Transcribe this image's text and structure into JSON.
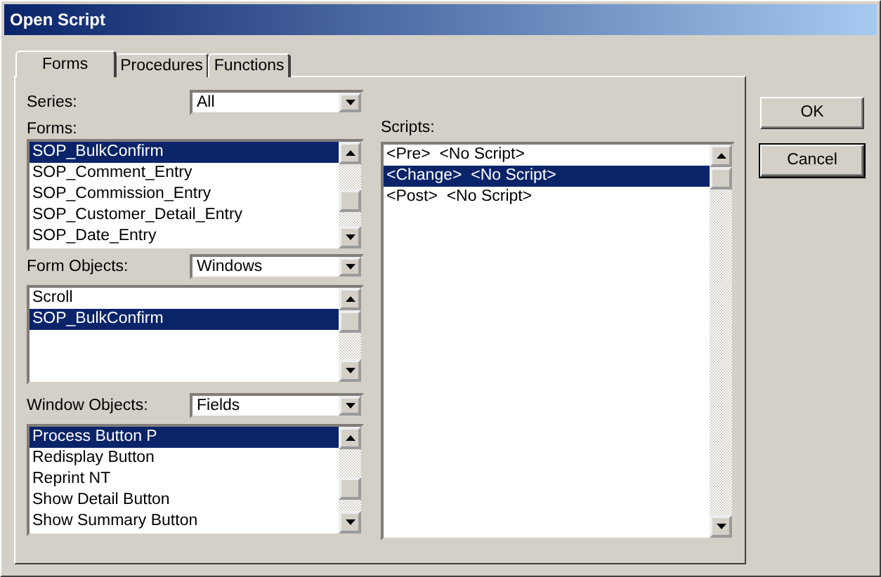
{
  "window": {
    "title": "Open Script"
  },
  "tabs": [
    {
      "label": "Forms",
      "selected": true
    },
    {
      "label": "Procedures",
      "selected": false
    },
    {
      "label": "Functions",
      "selected": false
    }
  ],
  "series": {
    "label": "Series:",
    "value": "All"
  },
  "forms": {
    "label": "Forms:",
    "items": [
      {
        "text": "SOP_BulkConfirm",
        "selected": true
      },
      {
        "text": "SOP_Comment_Entry",
        "selected": false
      },
      {
        "text": "SOP_Commission_Entry",
        "selected": false
      },
      {
        "text": "SOP_Customer_Detail_Entry",
        "selected": false
      },
      {
        "text": "SOP_Date_Entry",
        "selected": false
      }
    ]
  },
  "form_objects": {
    "label": "Form Objects:",
    "value": "Windows",
    "items": [
      {
        "text": "Scroll",
        "selected": false
      },
      {
        "text": "SOP_BulkConfirm",
        "selected": true
      }
    ]
  },
  "window_objects": {
    "label": "Window Objects:",
    "value": "Fields",
    "items": [
      {
        "text": "Process Button P",
        "selected": true
      },
      {
        "text": "Redisplay Button",
        "selected": false
      },
      {
        "text": "Reprint NT",
        "selected": false
      },
      {
        "text": "Show Detail Button",
        "selected": false
      },
      {
        "text": "Show Summary Button",
        "selected": false
      }
    ]
  },
  "scripts": {
    "label": "Scripts:",
    "items": [
      {
        "text": "<Pre>  <No Script>",
        "selected": false
      },
      {
        "text": "<Change>  <No Script>",
        "selected": true
      },
      {
        "text": "<Post>  <No Script>",
        "selected": false
      }
    ]
  },
  "buttons": [
    {
      "label": "OK",
      "default": false
    },
    {
      "label": "Cancel",
      "default": true
    }
  ]
}
